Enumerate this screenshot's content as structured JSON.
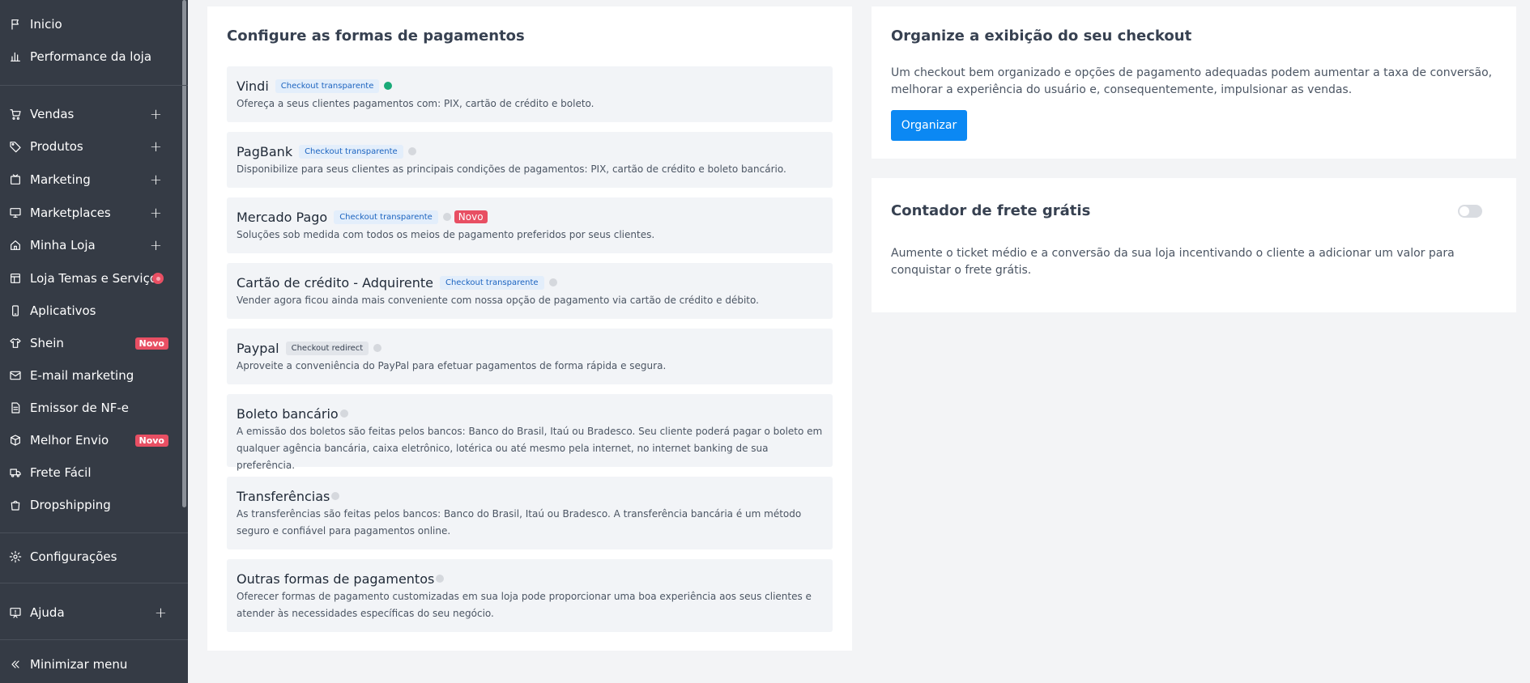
{
  "sidebar": {
    "items": [
      {
        "key": "inicio",
        "label": "Inicio",
        "icon": "flag-icon"
      },
      {
        "key": "performance",
        "label": "Performance da loja",
        "icon": "bar-chart-icon"
      },
      {
        "key": "vendas",
        "label": "Vendas",
        "icon": "cart-icon",
        "plus": "+"
      },
      {
        "key": "produtos",
        "label": "Produtos",
        "icon": "tag-icon",
        "plus": "+"
      },
      {
        "key": "marketing",
        "label": "Marketing",
        "icon": "calendar-icon",
        "plus": "+"
      },
      {
        "key": "marketplaces",
        "label": "Marketplaces",
        "icon": "monitor-icon",
        "plus": "+"
      },
      {
        "key": "minha-loja",
        "label": "Minha Loja",
        "icon": "home-icon",
        "plus": "+"
      },
      {
        "key": "temas",
        "label": "Loja Temas e Serviços",
        "icon": "layout-icon"
      },
      {
        "key": "aplicativos",
        "label": "Aplicativos",
        "icon": "smartphone-icon"
      },
      {
        "key": "shein",
        "label": "Shein",
        "icon": "shirt-icon",
        "badge": "Novo"
      },
      {
        "key": "email",
        "label": "E-mail marketing",
        "icon": "mail-icon"
      },
      {
        "key": "nfe",
        "label": "Emissor de NF-e",
        "icon": "file-icon"
      },
      {
        "key": "melhor-envio",
        "label": "Melhor Envio",
        "icon": "box-icon",
        "badge": "Novo"
      },
      {
        "key": "frete-facil",
        "label": "Frete Fácil",
        "icon": "truck-icon"
      },
      {
        "key": "dropshipping",
        "label": "Dropshipping",
        "icon": "bag-icon"
      },
      {
        "key": "configuracoes",
        "label": "Configurações",
        "icon": "gear-icon"
      },
      {
        "key": "ajuda",
        "label": "Ajuda",
        "icon": "help-icon",
        "plus": "+"
      },
      {
        "key": "minimizar",
        "label": "Minimizar menu",
        "icon": "chevrons-left-icon"
      }
    ]
  },
  "payments": {
    "title": "Configure as formas de pagamentos",
    "items": [
      {
        "name": "Vindi",
        "tag": "Checkout transparente",
        "active": true,
        "desc": "Ofereça a seus clientes pagamentos com: PIX, cartão de crédito e boleto."
      },
      {
        "name": "PagBank",
        "tag": "Checkout transparente",
        "active": false,
        "desc": "Disponibilize para seus clientes as principais condições de pagamentos: PIX, cartão de crédito e boleto bancário."
      },
      {
        "name": "Mercado Pago",
        "tag": "Checkout transparente",
        "active": false,
        "badge": "Novo",
        "desc": "Soluções sob medida com todos os meios de pagamento preferidos por seus clientes."
      },
      {
        "name": "Cartão de crédito - Adquirente",
        "tag": "Checkout transparente",
        "active": false,
        "desc": "Vender agora ficou ainda mais conveniente com nossa opção de pagamento via cartão de crédito e débito."
      },
      {
        "name": "Paypal",
        "tag": "Checkout redirect",
        "active": false,
        "desc": "Aproveite a conveniência do PayPal para efetuar pagamentos de forma rápida e segura."
      },
      {
        "name": "Boleto bancário",
        "active": false,
        "desc": "A emissão dos boletos são feitas pelos bancos: Banco do Brasil, Itaú ou Bradesco. Seu cliente poderá pagar o boleto em qualquer agência bancária, caixa eletrônico, lotérica ou até mesmo pela internet, no internet banking de sua preferência."
      },
      {
        "name": "Transferências",
        "active": false,
        "desc": "As transferências são feitas pelos bancos: Banco do Brasil, Itaú ou Bradesco. A transferência bancária é um método seguro e confiável para pagamentos online."
      },
      {
        "name": "Outras formas de pagamentos",
        "active": false,
        "desc": "Oferecer formas de pagamento customizadas em sua loja pode proporcionar uma boa experiência aos seus clientes e atender às necessidades específicas do seu negócio."
      }
    ]
  },
  "organize": {
    "title": "Organize a exibição do seu checkout",
    "desc": "Um checkout bem organizado e opções de pagamento adequadas podem aumentar a taxa de conversão, melhorar a experiência do usuário e, consequentemente, impulsionar as vendas.",
    "button": "Organizar"
  },
  "frete": {
    "title": "Contador de frete grátis",
    "enabled": false,
    "desc": "Aumente o ticket médio e a conversão da sua loja incentivando o cliente a adicionar um valor para conquistar o frete grátis."
  },
  "colors": {
    "sidebar_bg": "#353b45",
    "primary": "#0b88f3",
    "badge_red": "#e84f63",
    "active_green": "#1aaa78"
  }
}
